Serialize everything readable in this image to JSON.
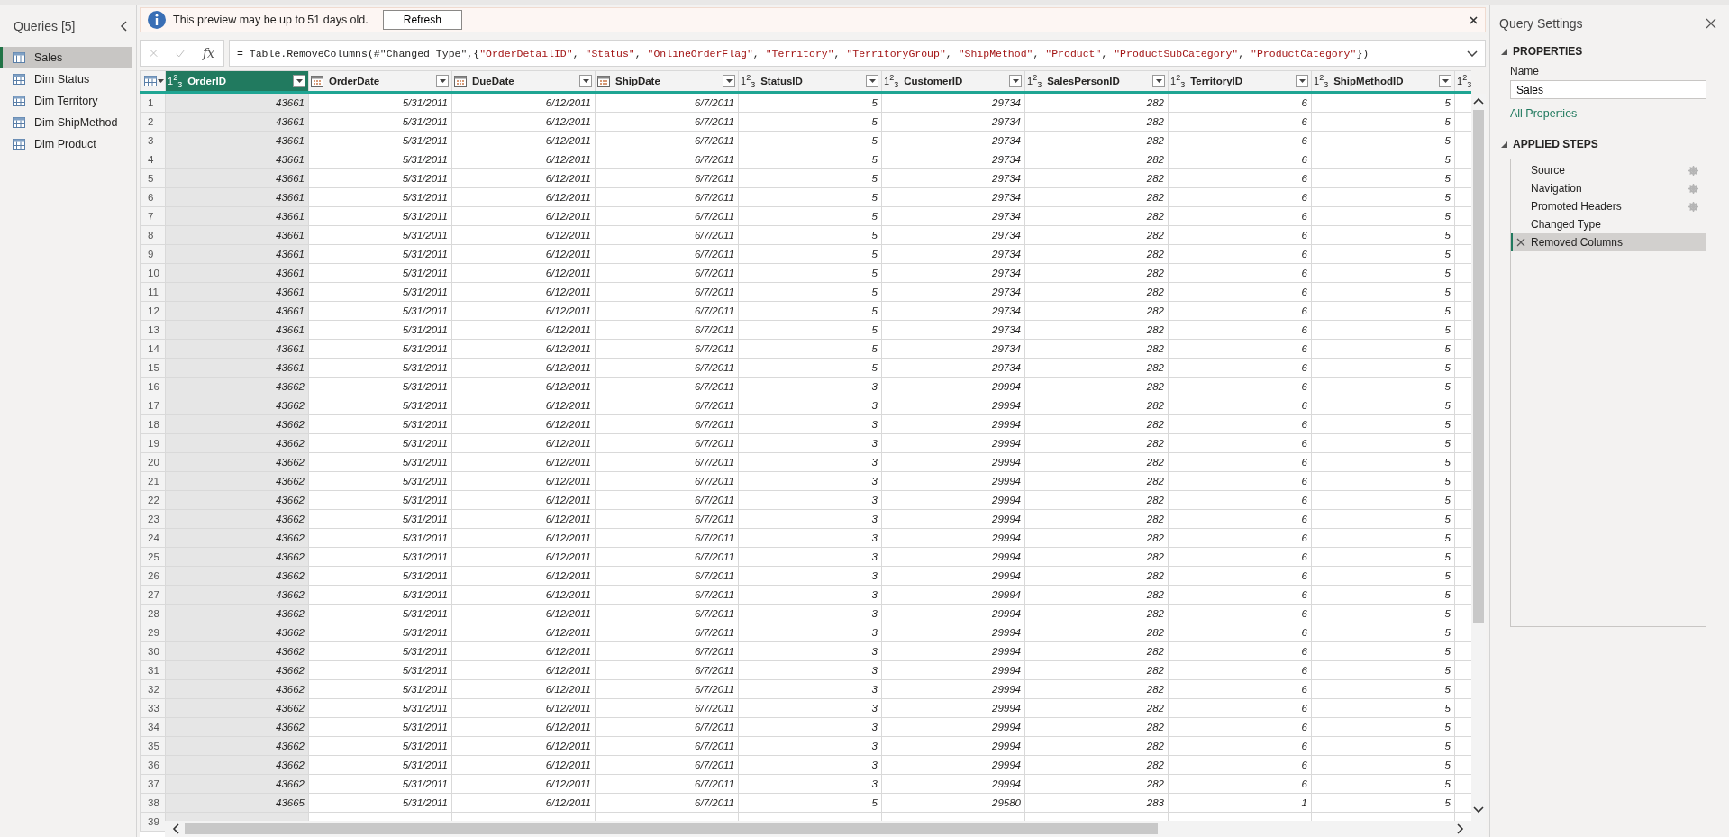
{
  "queries_pane": {
    "title": "Queries [5]",
    "items": [
      {
        "label": "Sales",
        "selected": true
      },
      {
        "label": "Dim Status",
        "selected": false
      },
      {
        "label": "Dim Territory",
        "selected": false
      },
      {
        "label": "Dim ShipMethod",
        "selected": false
      },
      {
        "label": "Dim Product",
        "selected": false
      }
    ]
  },
  "info_bar": {
    "message": "This preview may be up to 51 days old.",
    "button": "Refresh"
  },
  "formula_bar": {
    "fx": "fx",
    "tokens": [
      {
        "kind": "code",
        "text": "= Table.RemoveColumns(#\"Changed Type\",{"
      },
      {
        "kind": "string",
        "text": "\"OrderDetailID\""
      },
      {
        "kind": "code",
        "text": ", "
      },
      {
        "kind": "string",
        "text": "\"Status\""
      },
      {
        "kind": "code",
        "text": ", "
      },
      {
        "kind": "string",
        "text": "\"OnlineOrderFlag\""
      },
      {
        "kind": "code",
        "text": ", "
      },
      {
        "kind": "string",
        "text": "\"Territory\""
      },
      {
        "kind": "code",
        "text": ", "
      },
      {
        "kind": "string",
        "text": "\"TerritoryGroup\""
      },
      {
        "kind": "code",
        "text": ", "
      },
      {
        "kind": "string",
        "text": "\"ShipMethod\""
      },
      {
        "kind": "code",
        "text": ", "
      },
      {
        "kind": "string",
        "text": "\"Product\""
      },
      {
        "kind": "code",
        "text": ", "
      },
      {
        "kind": "string",
        "text": "\"ProductSubCategory\""
      },
      {
        "kind": "code",
        "text": ", "
      },
      {
        "kind": "string",
        "text": "\"ProductCategory\""
      },
      {
        "kind": "code",
        "text": "})"
      }
    ]
  },
  "table": {
    "columns": [
      {
        "name": "OrderID",
        "kind": "number",
        "type_label": "1$^{2}$$_{3}$",
        "selected": true
      },
      {
        "name": "OrderDate",
        "kind": "date",
        "selected": false
      },
      {
        "name": "DueDate",
        "kind": "date",
        "selected": false
      },
      {
        "name": "ShipDate",
        "kind": "date",
        "selected": false
      },
      {
        "name": "StatusID",
        "kind": "number",
        "type_label": "1$^{2}$$_{3}$",
        "selected": false
      },
      {
        "name": "CustomerID",
        "kind": "number",
        "type_label": "1$^{2}$$_{3}$",
        "selected": false
      },
      {
        "name": "SalesPersonID",
        "kind": "number",
        "type_label": "1$^{2}$$_{3}$",
        "selected": false
      },
      {
        "name": "TerritoryID",
        "kind": "number",
        "type_label": "1$^{2}$$_{3}$",
        "selected": false
      },
      {
        "name": "ShipMethodID",
        "kind": "number",
        "type_label": "1$^{2}$$_{3}$",
        "selected": false
      },
      {
        "kind": "number",
        "type_label": "1$^{2}$$_{3}$",
        "selected": false
      }
    ],
    "rows": [
      {
        "index": "1",
        "cells": [
          "43661",
          "5/31/2011",
          "6/12/2011",
          "6/7/2011",
          "5",
          "29734",
          "282",
          "6",
          "5"
        ]
      },
      {
        "index": "2",
        "cells": [
          "43661",
          "5/31/2011",
          "6/12/2011",
          "6/7/2011",
          "5",
          "29734",
          "282",
          "6",
          "5"
        ]
      },
      {
        "index": "3",
        "cells": [
          "43661",
          "5/31/2011",
          "6/12/2011",
          "6/7/2011",
          "5",
          "29734",
          "282",
          "6",
          "5"
        ]
      },
      {
        "index": "4",
        "cells": [
          "43661",
          "5/31/2011",
          "6/12/2011",
          "6/7/2011",
          "5",
          "29734",
          "282",
          "6",
          "5"
        ]
      },
      {
        "index": "5",
        "cells": [
          "43661",
          "5/31/2011",
          "6/12/2011",
          "6/7/2011",
          "5",
          "29734",
          "282",
          "6",
          "5"
        ]
      },
      {
        "index": "6",
        "cells": [
          "43661",
          "5/31/2011",
          "6/12/2011",
          "6/7/2011",
          "5",
          "29734",
          "282",
          "6",
          "5"
        ]
      },
      {
        "index": "7",
        "cells": [
          "43661",
          "5/31/2011",
          "6/12/2011",
          "6/7/2011",
          "5",
          "29734",
          "282",
          "6",
          "5"
        ]
      },
      {
        "index": "8",
        "cells": [
          "43661",
          "5/31/2011",
          "6/12/2011",
          "6/7/2011",
          "5",
          "29734",
          "282",
          "6",
          "5"
        ]
      },
      {
        "index": "9",
        "cells": [
          "43661",
          "5/31/2011",
          "6/12/2011",
          "6/7/2011",
          "5",
          "29734",
          "282",
          "6",
          "5"
        ]
      },
      {
        "index": "10",
        "cells": [
          "43661",
          "5/31/2011",
          "6/12/2011",
          "6/7/2011",
          "5",
          "29734",
          "282",
          "6",
          "5"
        ]
      },
      {
        "index": "11",
        "cells": [
          "43661",
          "5/31/2011",
          "6/12/2011",
          "6/7/2011",
          "5",
          "29734",
          "282",
          "6",
          "5"
        ]
      },
      {
        "index": "12",
        "cells": [
          "43661",
          "5/31/2011",
          "6/12/2011",
          "6/7/2011",
          "5",
          "29734",
          "282",
          "6",
          "5"
        ]
      },
      {
        "index": "13",
        "cells": [
          "43661",
          "5/31/2011",
          "6/12/2011",
          "6/7/2011",
          "5",
          "29734",
          "282",
          "6",
          "5"
        ]
      },
      {
        "index": "14",
        "cells": [
          "43661",
          "5/31/2011",
          "6/12/2011",
          "6/7/2011",
          "5",
          "29734",
          "282",
          "6",
          "5"
        ]
      },
      {
        "index": "15",
        "cells": [
          "43661",
          "5/31/2011",
          "6/12/2011",
          "6/7/2011",
          "5",
          "29734",
          "282",
          "6",
          "5"
        ]
      },
      {
        "index": "16",
        "cells": [
          "43662",
          "5/31/2011",
          "6/12/2011",
          "6/7/2011",
          "3",
          "29994",
          "282",
          "6",
          "5"
        ]
      },
      {
        "index": "17",
        "cells": [
          "43662",
          "5/31/2011",
          "6/12/2011",
          "6/7/2011",
          "3",
          "29994",
          "282",
          "6",
          "5"
        ]
      },
      {
        "index": "18",
        "cells": [
          "43662",
          "5/31/2011",
          "6/12/2011",
          "6/7/2011",
          "3",
          "29994",
          "282",
          "6",
          "5"
        ]
      },
      {
        "index": "19",
        "cells": [
          "43662",
          "5/31/2011",
          "6/12/2011",
          "6/7/2011",
          "3",
          "29994",
          "282",
          "6",
          "5"
        ]
      },
      {
        "index": "20",
        "cells": [
          "43662",
          "5/31/2011",
          "6/12/2011",
          "6/7/2011",
          "3",
          "29994",
          "282",
          "6",
          "5"
        ]
      },
      {
        "index": "21",
        "cells": [
          "43662",
          "5/31/2011",
          "6/12/2011",
          "6/7/2011",
          "3",
          "29994",
          "282",
          "6",
          "5"
        ]
      },
      {
        "index": "22",
        "cells": [
          "43662",
          "5/31/2011",
          "6/12/2011",
          "6/7/2011",
          "3",
          "29994",
          "282",
          "6",
          "5"
        ]
      },
      {
        "index": "23",
        "cells": [
          "43662",
          "5/31/2011",
          "6/12/2011",
          "6/7/2011",
          "3",
          "29994",
          "282",
          "6",
          "5"
        ]
      },
      {
        "index": "24",
        "cells": [
          "43662",
          "5/31/2011",
          "6/12/2011",
          "6/7/2011",
          "3",
          "29994",
          "282",
          "6",
          "5"
        ]
      },
      {
        "index": "25",
        "cells": [
          "43662",
          "5/31/2011",
          "6/12/2011",
          "6/7/2011",
          "3",
          "29994",
          "282",
          "6",
          "5"
        ]
      },
      {
        "index": "26",
        "cells": [
          "43662",
          "5/31/2011",
          "6/12/2011",
          "6/7/2011",
          "3",
          "29994",
          "282",
          "6",
          "5"
        ]
      },
      {
        "index": "27",
        "cells": [
          "43662",
          "5/31/2011",
          "6/12/2011",
          "6/7/2011",
          "3",
          "29994",
          "282",
          "6",
          "5"
        ]
      },
      {
        "index": "28",
        "cells": [
          "43662",
          "5/31/2011",
          "6/12/2011",
          "6/7/2011",
          "3",
          "29994",
          "282",
          "6",
          "5"
        ]
      },
      {
        "index": "29",
        "cells": [
          "43662",
          "5/31/2011",
          "6/12/2011",
          "6/7/2011",
          "3",
          "29994",
          "282",
          "6",
          "5"
        ]
      },
      {
        "index": "30",
        "cells": [
          "43662",
          "5/31/2011",
          "6/12/2011",
          "6/7/2011",
          "3",
          "29994",
          "282",
          "6",
          "5"
        ]
      },
      {
        "index": "31",
        "cells": [
          "43662",
          "5/31/2011",
          "6/12/2011",
          "6/7/2011",
          "3",
          "29994",
          "282",
          "6",
          "5"
        ]
      },
      {
        "index": "32",
        "cells": [
          "43662",
          "5/31/2011",
          "6/12/2011",
          "6/7/2011",
          "3",
          "29994",
          "282",
          "6",
          "5"
        ]
      },
      {
        "index": "33",
        "cells": [
          "43662",
          "5/31/2011",
          "6/12/2011",
          "6/7/2011",
          "3",
          "29994",
          "282",
          "6",
          "5"
        ]
      },
      {
        "index": "34",
        "cells": [
          "43662",
          "5/31/2011",
          "6/12/2011",
          "6/7/2011",
          "3",
          "29994",
          "282",
          "6",
          "5"
        ]
      },
      {
        "index": "35",
        "cells": [
          "43662",
          "5/31/2011",
          "6/12/2011",
          "6/7/2011",
          "3",
          "29994",
          "282",
          "6",
          "5"
        ]
      },
      {
        "index": "36",
        "cells": [
          "43662",
          "5/31/2011",
          "6/12/2011",
          "6/7/2011",
          "3",
          "29994",
          "282",
          "6",
          "5"
        ]
      },
      {
        "index": "37",
        "cells": [
          "43662",
          "5/31/2011",
          "6/12/2011",
          "6/7/2011",
          "3",
          "29994",
          "282",
          "6",
          "5"
        ]
      },
      {
        "index": "38",
        "cells": [
          "43665",
          "5/31/2011",
          "6/12/2011",
          "6/7/2011",
          "5",
          "29580",
          "283",
          "1",
          "5"
        ]
      },
      {
        "index": "39"
      }
    ]
  },
  "query_settings": {
    "title": "Query Settings",
    "properties": {
      "heading": "PROPERTIES",
      "name_label": "Name",
      "name_value": "Sales",
      "link": "All Properties"
    },
    "applied_steps": {
      "heading": "APPLIED STEPS",
      "steps": [
        {
          "label": "Source",
          "has_settings": true,
          "selected": false
        },
        {
          "label": "Navigation",
          "has_settings": true,
          "selected": false
        },
        {
          "label": "Promoted Headers",
          "has_settings": true,
          "selected": false
        },
        {
          "label": "Changed Type",
          "has_settings": false,
          "selected": false
        },
        {
          "label": "Removed Columns",
          "has_settings": false,
          "selected": true
        }
      ]
    }
  }
}
